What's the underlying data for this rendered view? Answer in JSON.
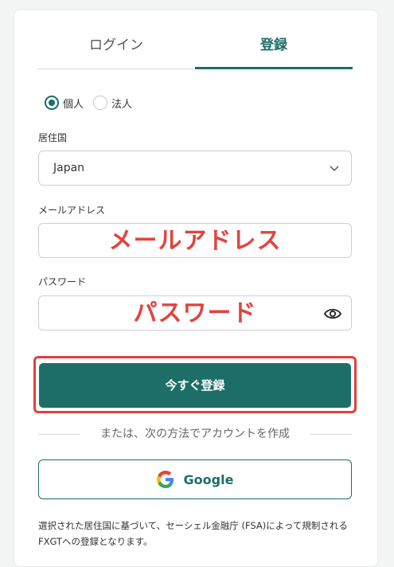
{
  "tabs": {
    "login": "ログイン",
    "register": "登録"
  },
  "account_type": {
    "individual": "個人",
    "corporate": "法人",
    "selected": "individual"
  },
  "country": {
    "label": "居住国",
    "value": "Japan"
  },
  "email": {
    "label": "メールアドレス",
    "overlay": "メールアドレス"
  },
  "password": {
    "label": "パスワード",
    "overlay": "パスワード"
  },
  "submit": {
    "label": "今すぐ登録"
  },
  "divider": {
    "text": "または、次の方法でアカウントを作成"
  },
  "google": {
    "label": "Google"
  },
  "notice": {
    "text": "選択された居住国に基づいて、セーシェル金融庁 (FSA)によって規制されるFXGTへの登録となります。"
  },
  "colors": {
    "accent": "#1c6e66",
    "annotation": "#e1443d"
  }
}
